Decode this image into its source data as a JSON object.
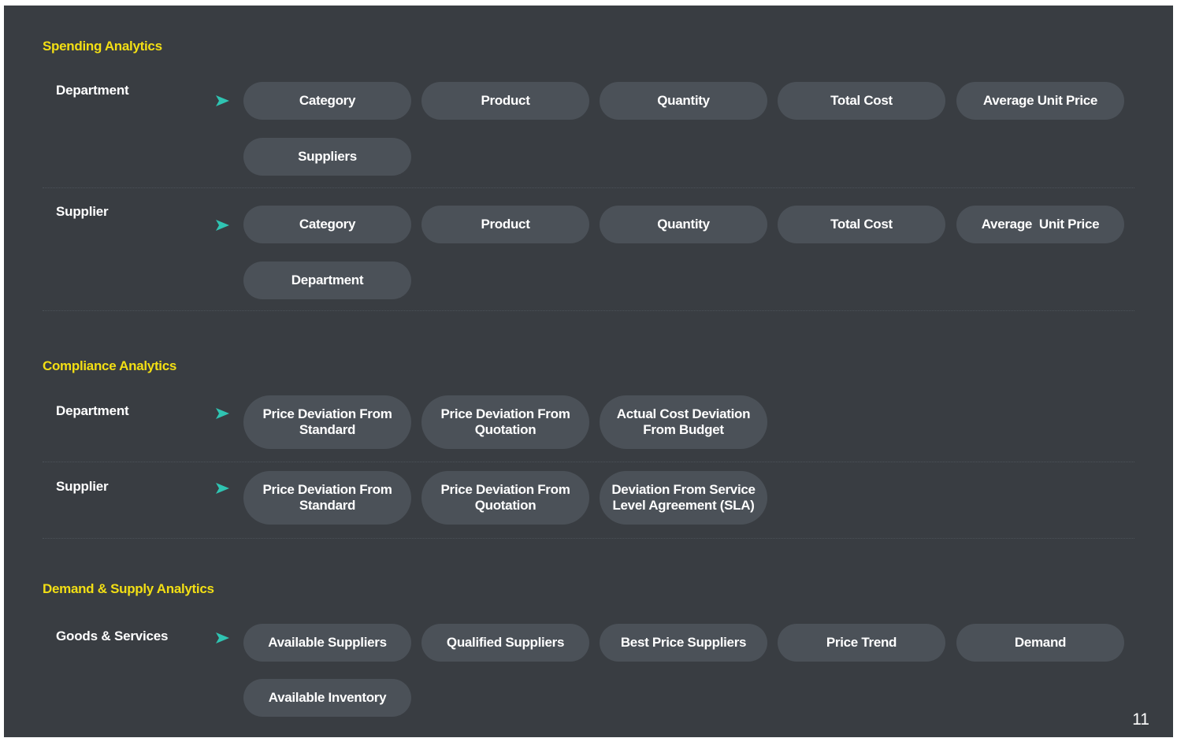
{
  "sections": {
    "spending": {
      "title": "Spending Analytics",
      "rows": [
        {
          "label": "Department",
          "items": [
            "Category",
            "Product",
            "Quantity",
            "Total Cost",
            "Average Unit Price",
            "Suppliers"
          ]
        },
        {
          "label": "Supplier",
          "items": [
            "Category",
            "Product",
            "Quantity",
            "Total Cost",
            "Average  Unit Price",
            "Department"
          ]
        }
      ]
    },
    "compliance": {
      "title": "Compliance Analytics",
      "rows": [
        {
          "label": "Department",
          "items": [
            "Price Deviation From Standard",
            "Price Deviation From Quotation",
            "Actual Cost Deviation From Budget"
          ]
        },
        {
          "label": "Supplier",
          "items": [
            "Price Deviation From Standard",
            "Price Deviation From Quotation",
            "Deviation From Service Level Agreement (SLA)"
          ]
        }
      ]
    },
    "demand": {
      "title": "Demand & Supply Analytics",
      "rows": [
        {
          "label": "Goods & Services",
          "items": [
            "Available Suppliers",
            "Qualified Suppliers",
            "Best Price Suppliers",
            "Price Trend",
            "Demand",
            "Available Inventory"
          ]
        }
      ]
    }
  },
  "arrow_icon": "arrow-right-icon",
  "colors": {
    "background": "#393d42",
    "section_title": "#f3df14",
    "pill": "#4b5158",
    "arrow": "#2fc4b2"
  },
  "page_number": "11"
}
